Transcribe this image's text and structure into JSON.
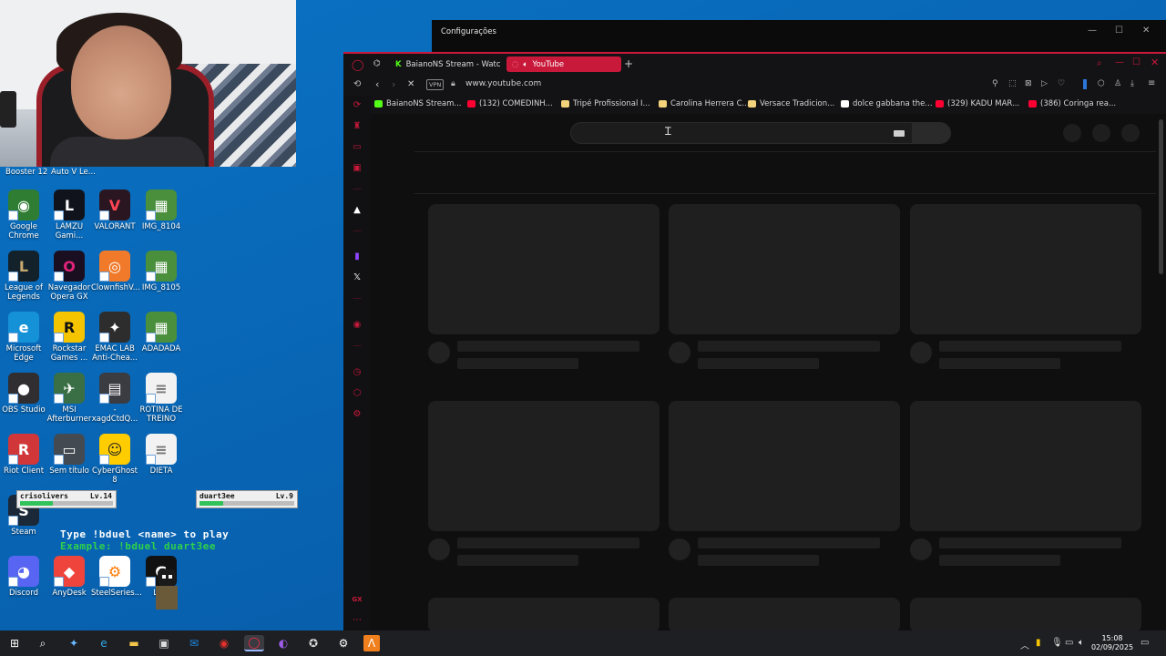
{
  "desktop": {
    "top_labels": [
      "Booster 12",
      "Auto V Le..."
    ],
    "icons": [
      {
        "label": "Google Chrome",
        "glyph": "◉",
        "color": "#ffffff",
        "bg": "#2f7d32"
      },
      {
        "label": "LAMZU Gami...",
        "glyph": "L",
        "color": "#ffffff",
        "bg": "#10131c"
      },
      {
        "label": "VALORANT",
        "glyph": "V",
        "color": "#ff4655",
        "bg": "#2a1620"
      },
      {
        "label": "IMG_8104",
        "glyph": "▦",
        "color": "#ffffff",
        "bg": "#4a8f3c"
      },
      {
        "label": "League of Legends",
        "glyph": "L",
        "color": "#c8aa6e",
        "bg": "#12212a"
      },
      {
        "label": "Navegador Opera GX",
        "glyph": "O",
        "color": "#e0247a",
        "bg": "#1a0f20"
      },
      {
        "label": "ClownfishV...",
        "glyph": "◎",
        "color": "#ffffff",
        "bg": "#f07a2a"
      },
      {
        "label": "IMG_8105",
        "glyph": "▦",
        "color": "#ffffff",
        "bg": "#4a8f3c"
      },
      {
        "label": "Microsoft Edge",
        "glyph": "e",
        "color": "#ffffff",
        "bg": "#1591d8"
      },
      {
        "label": "Rockstar Games ...",
        "glyph": "R",
        "color": "#111111",
        "bg": "#f5c400"
      },
      {
        "label": "EMAC LAB Anti-Chea...",
        "glyph": "✦",
        "color": "#ffffff",
        "bg": "#2d2d2d"
      },
      {
        "label": "ADADADA",
        "glyph": "▦",
        "color": "#ffffff",
        "bg": "#4a8f3c"
      },
      {
        "label": "OBS Studio",
        "glyph": "●",
        "color": "#ffffff",
        "bg": "#302e31"
      },
      {
        "label": "MSI Afterburner",
        "glyph": "✈",
        "color": "#ffffff",
        "bg": "#3a6f46"
      },
      {
        "label": "-xagdCtdQ...",
        "glyph": "▤",
        "color": "#ffffff",
        "bg": "#3b3b42"
      },
      {
        "label": "ROTINA DE TREINO",
        "glyph": "≡",
        "color": "#777777",
        "bg": "#f2f2f2"
      },
      {
        "label": "Riot Client",
        "glyph": "R",
        "color": "#ffffff",
        "bg": "#d13639"
      },
      {
        "label": "Sem título",
        "glyph": "▭",
        "color": "#ffffff",
        "bg": "#444a52"
      },
      {
        "label": "CyberGhost 8",
        "glyph": "☺",
        "color": "#222222",
        "bg": "#ffcc00"
      },
      {
        "label": "DIETA",
        "glyph": "≡",
        "color": "#777777",
        "bg": "#f2f2f2"
      },
      {
        "label": "Steam",
        "glyph": "S",
        "color": "#ffffff",
        "bg": "#1b2838"
      },
      {
        "label": "Discord",
        "glyph": "◕",
        "color": "#ffffff",
        "bg": "#5865f2"
      },
      {
        "label": "AnyDesk",
        "glyph": "◆",
        "color": "#ffffff",
        "bg": "#ef443b"
      },
      {
        "label": "SteelSeries...",
        "glyph": "⚙",
        "color": "#ff7a00",
        "bg": "#ffffff"
      },
      {
        "label": "Lo...",
        "glyph": "G",
        "color": "#ffffff",
        "bg": "#111111"
      }
    ]
  },
  "overlay": {
    "player1": {
      "name": "crisolivers",
      "level": "Lv.14",
      "hp": "HP:"
    },
    "player2": {
      "name": "duart3ee",
      "level": "Lv.9",
      "hp": "HP:"
    },
    "line1": "Type !bduel <name> to play",
    "line2": "Example: !bduel duart3ee",
    "line1_color": "#ffffff",
    "line2_color": "#2fd14a"
  },
  "settings_window": {
    "title": "Configurações"
  },
  "browser": {
    "tabs": [
      {
        "label": "BaianoNS Stream - Watch",
        "icon": "kick-icon"
      },
      {
        "label": "YouTube",
        "icon": "speaker-icon"
      }
    ],
    "add_tab": "+",
    "vpn": "VPN",
    "url": "www.youtube.com",
    "bookmarks": [
      {
        "label": "BaianoNS Stream...",
        "color": "#53fc18"
      },
      {
        "label": "(132) COMEDINH...",
        "color": "#ff0033"
      },
      {
        "label": "Tripé Profissional I...",
        "color": "#f2d27a"
      },
      {
        "label": "Carolina Herrera C...",
        "color": "#f2d27a"
      },
      {
        "label": "Versace Tradicion...",
        "color": "#f2d27a"
      },
      {
        "label": "dolce gabbana the...",
        "color": "#ffffff"
      },
      {
        "label": "(329) KADU MAR...",
        "color": "#ff0033"
      },
      {
        "label": "(386) Coringa rea...",
        "color": "#ff0033"
      }
    ],
    "accent": "#c8193a"
  },
  "taskbar": {
    "time": "15:08",
    "date": "02/09/2025"
  }
}
